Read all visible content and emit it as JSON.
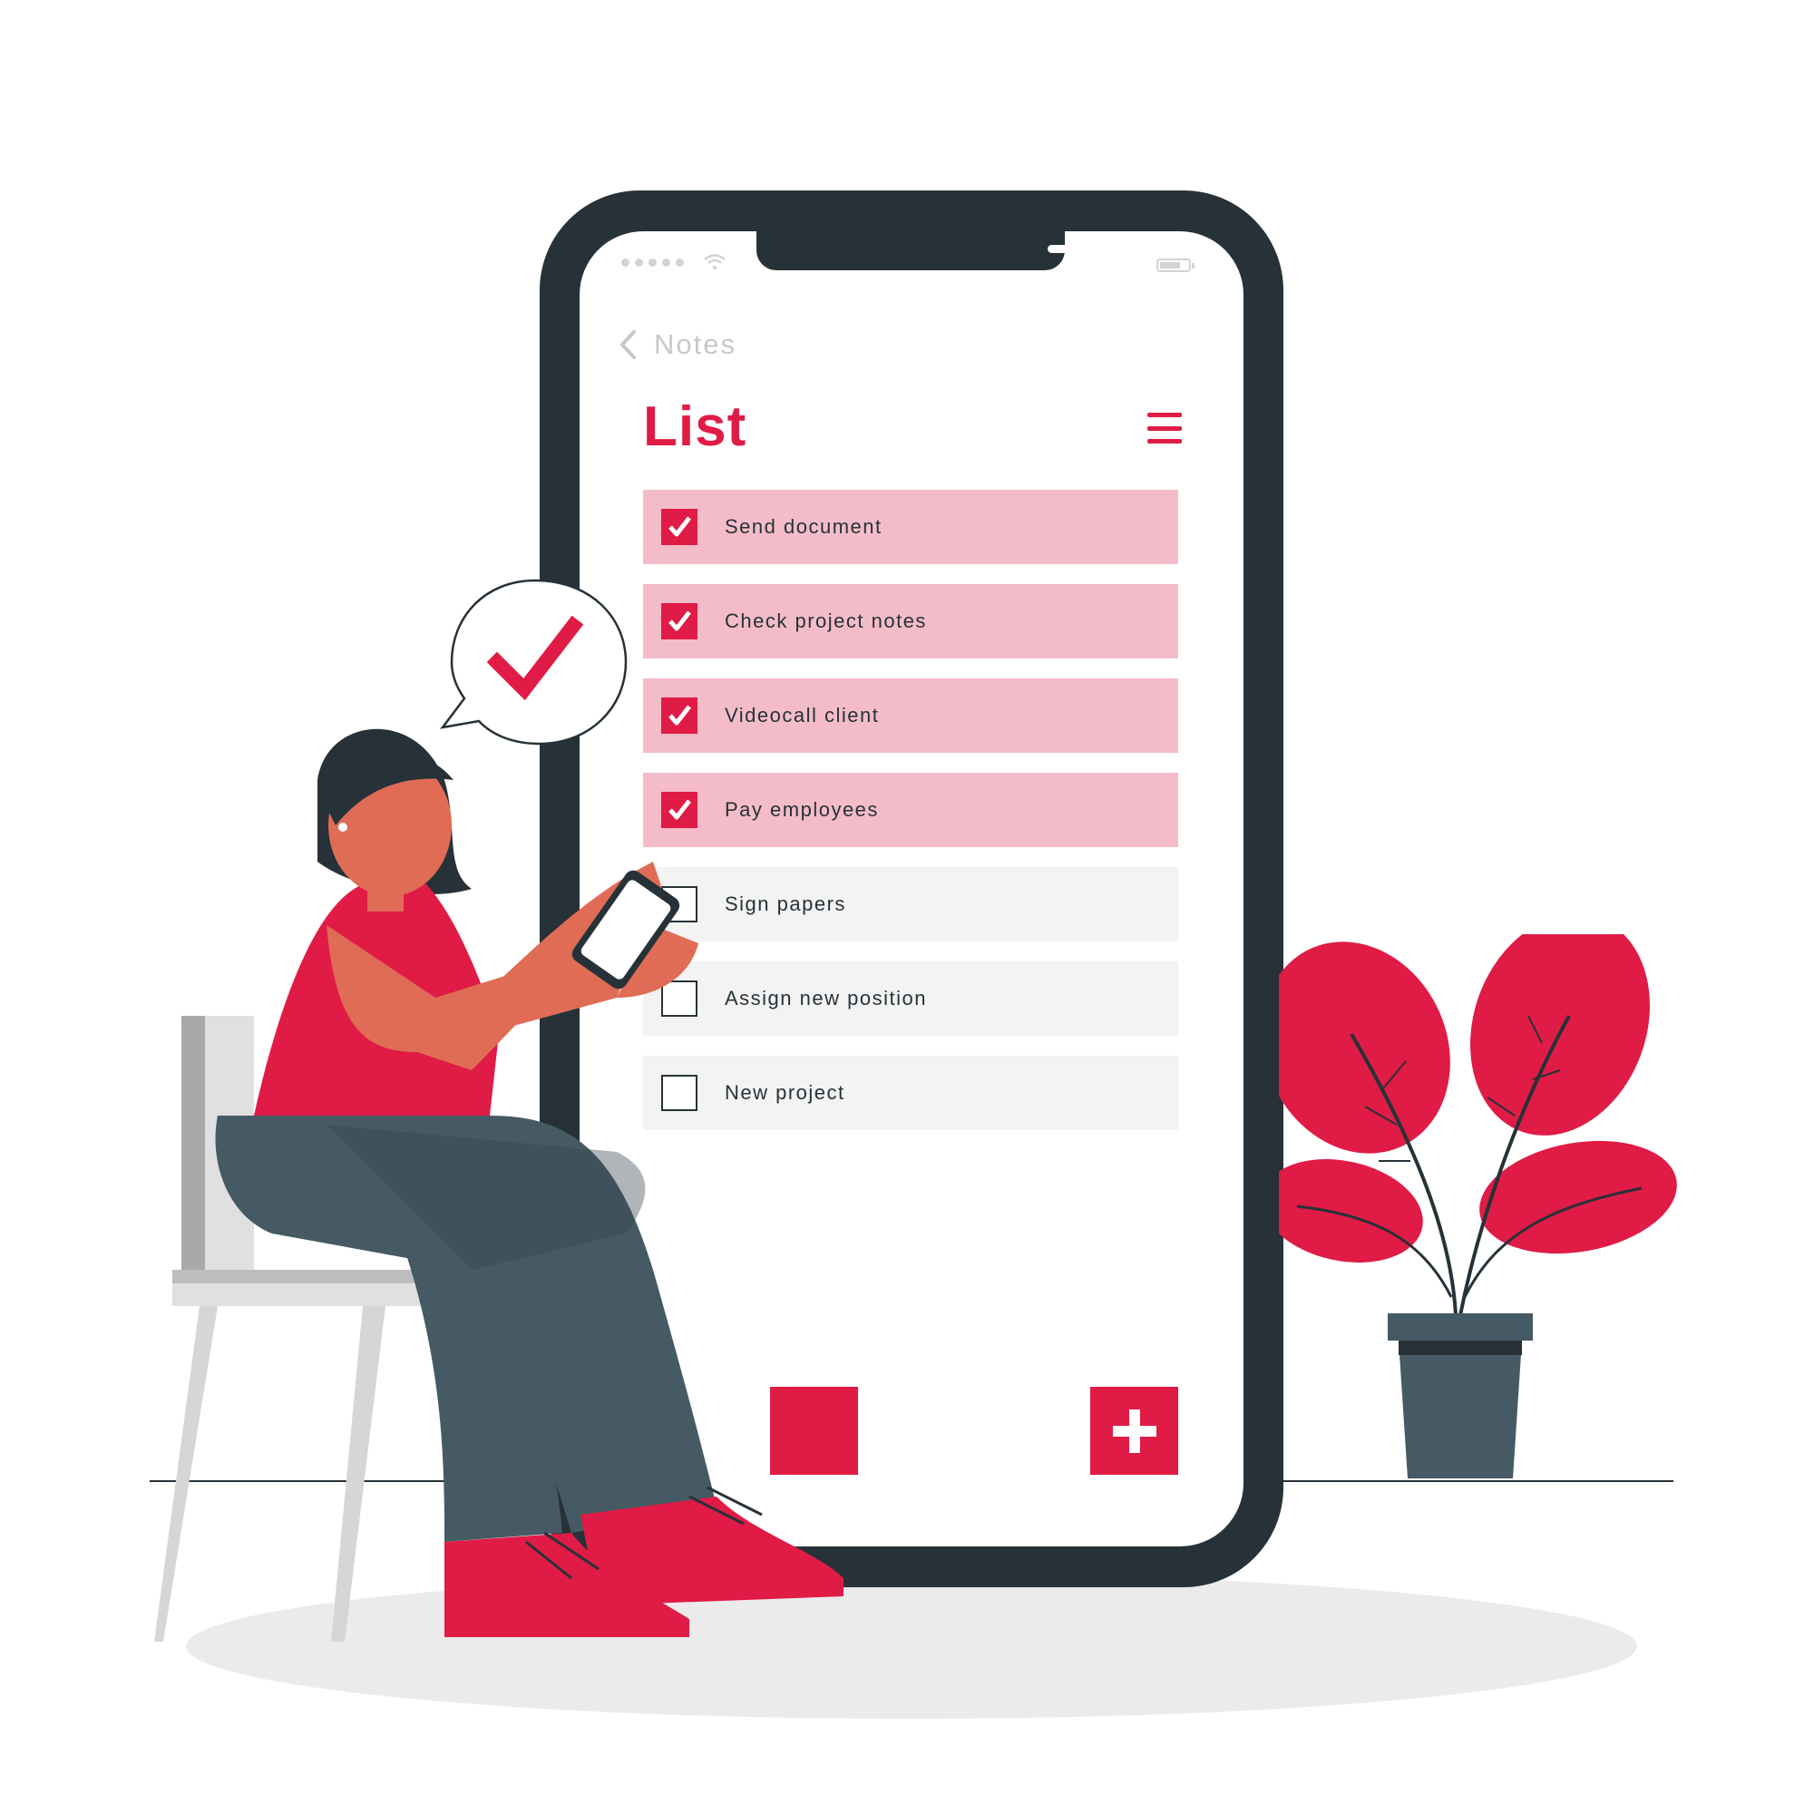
{
  "status_bar": {
    "signal_icon": "signal-dots-icon",
    "wifi_icon": "wifi-icon",
    "battery_icon": "battery-icon"
  },
  "nav": {
    "back_icon": "chevron-left-icon",
    "back_label": "Notes"
  },
  "header": {
    "title": "List",
    "menu_icon": "hamburger-menu-icon"
  },
  "list": {
    "items": [
      {
        "label": "Send document",
        "checked": true
      },
      {
        "label": "Check project notes",
        "checked": true
      },
      {
        "label": "Videocall client",
        "checked": true
      },
      {
        "label": "Pay employees",
        "checked": true
      },
      {
        "label": "Sign papers",
        "checked": false
      },
      {
        "label": "Assign new position",
        "checked": false
      },
      {
        "label": "New project",
        "checked": false
      }
    ]
  },
  "actions": {
    "add_icon": "plus-icon"
  },
  "colors": {
    "accent": "#e01b46",
    "accent_light": "#f4bcc9",
    "dark": "#263238",
    "unchecked_row": "#f3f3f3"
  }
}
